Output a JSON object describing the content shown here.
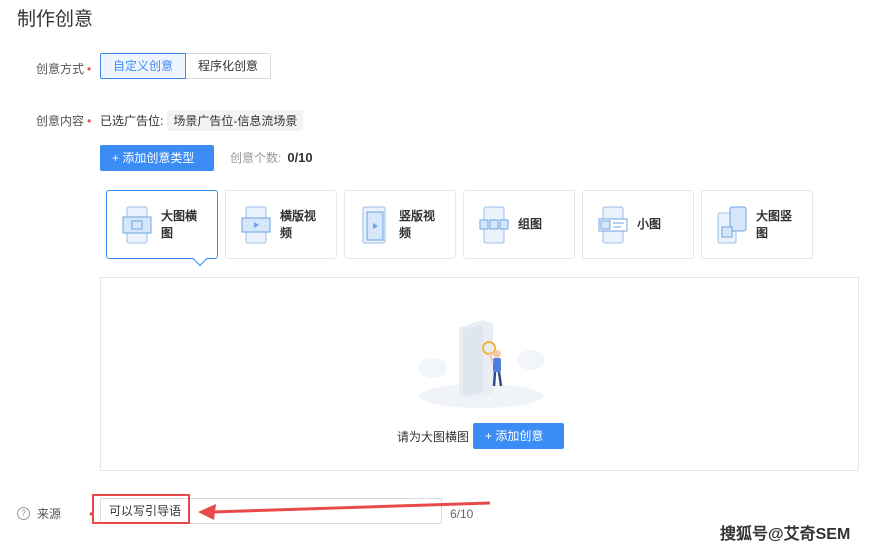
{
  "page": {
    "title": "制作创意"
  },
  "method": {
    "label": "创意方式",
    "required_mark": "•",
    "options": [
      "自定义创意",
      "程序化创意"
    ]
  },
  "content": {
    "label": "创意内容",
    "required_mark": "•",
    "prefix": "已选广告位:",
    "value": "场景广告位-信息流场景"
  },
  "add_type": {
    "label": "+ 添加创意类型",
    "count_label": "创意个数:",
    "count_value": "0/10"
  },
  "types": [
    {
      "label": "大图横图",
      "icon": "large-horizontal-image-icon",
      "selected": true
    },
    {
      "label": "横版视频",
      "icon": "horizontal-video-icon",
      "selected": false
    },
    {
      "label": "竖版视频",
      "icon": "vertical-video-icon",
      "selected": false
    },
    {
      "label": "组图",
      "icon": "image-group-icon",
      "selected": false
    },
    {
      "label": "小图",
      "icon": "small-image-icon",
      "selected": false
    },
    {
      "label": "大图竖图",
      "icon": "large-vertical-image-icon",
      "selected": false
    }
  ],
  "empty_state": {
    "hint": "请为大图横图",
    "button": "+ 添加创意"
  },
  "source": {
    "label": "来源",
    "help_glyph": "?",
    "required_mark": "•",
    "value": "可以写引导语",
    "count": "6/10"
  },
  "watermark": "搜狐号@艾奇SEM",
  "colors": {
    "accent": "#3b8cf5",
    "annotation": "#e84a4a"
  }
}
